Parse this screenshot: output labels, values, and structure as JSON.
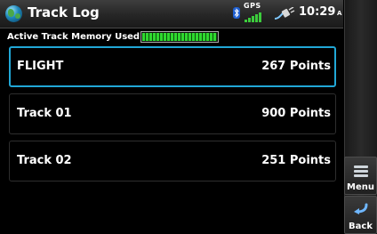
{
  "header": {
    "title": "Track Log",
    "gps_label": "GPS",
    "time": "10:29",
    "time_suffix": "A"
  },
  "memory": {
    "label": "Active Track Memory Used",
    "used_percent": 100
  },
  "tracks": [
    {
      "name": "FLIGHT",
      "points": "267 Points",
      "selected": true
    },
    {
      "name": "Track 01",
      "points": "900 Points",
      "selected": false
    },
    {
      "name": "Track 02",
      "points": "251 Points",
      "selected": false
    }
  ],
  "softkeys": {
    "menu_label": "Menu",
    "back_label": "Back"
  },
  "colors": {
    "selection_border": "#21a7d6",
    "memory_fill": "#2fd82f",
    "background": "#000000"
  },
  "icons": [
    "globe-icon",
    "bluetooth-icon",
    "gps-signal-icon",
    "power-plug-icon",
    "menu-icon",
    "back-arrow-icon"
  ]
}
